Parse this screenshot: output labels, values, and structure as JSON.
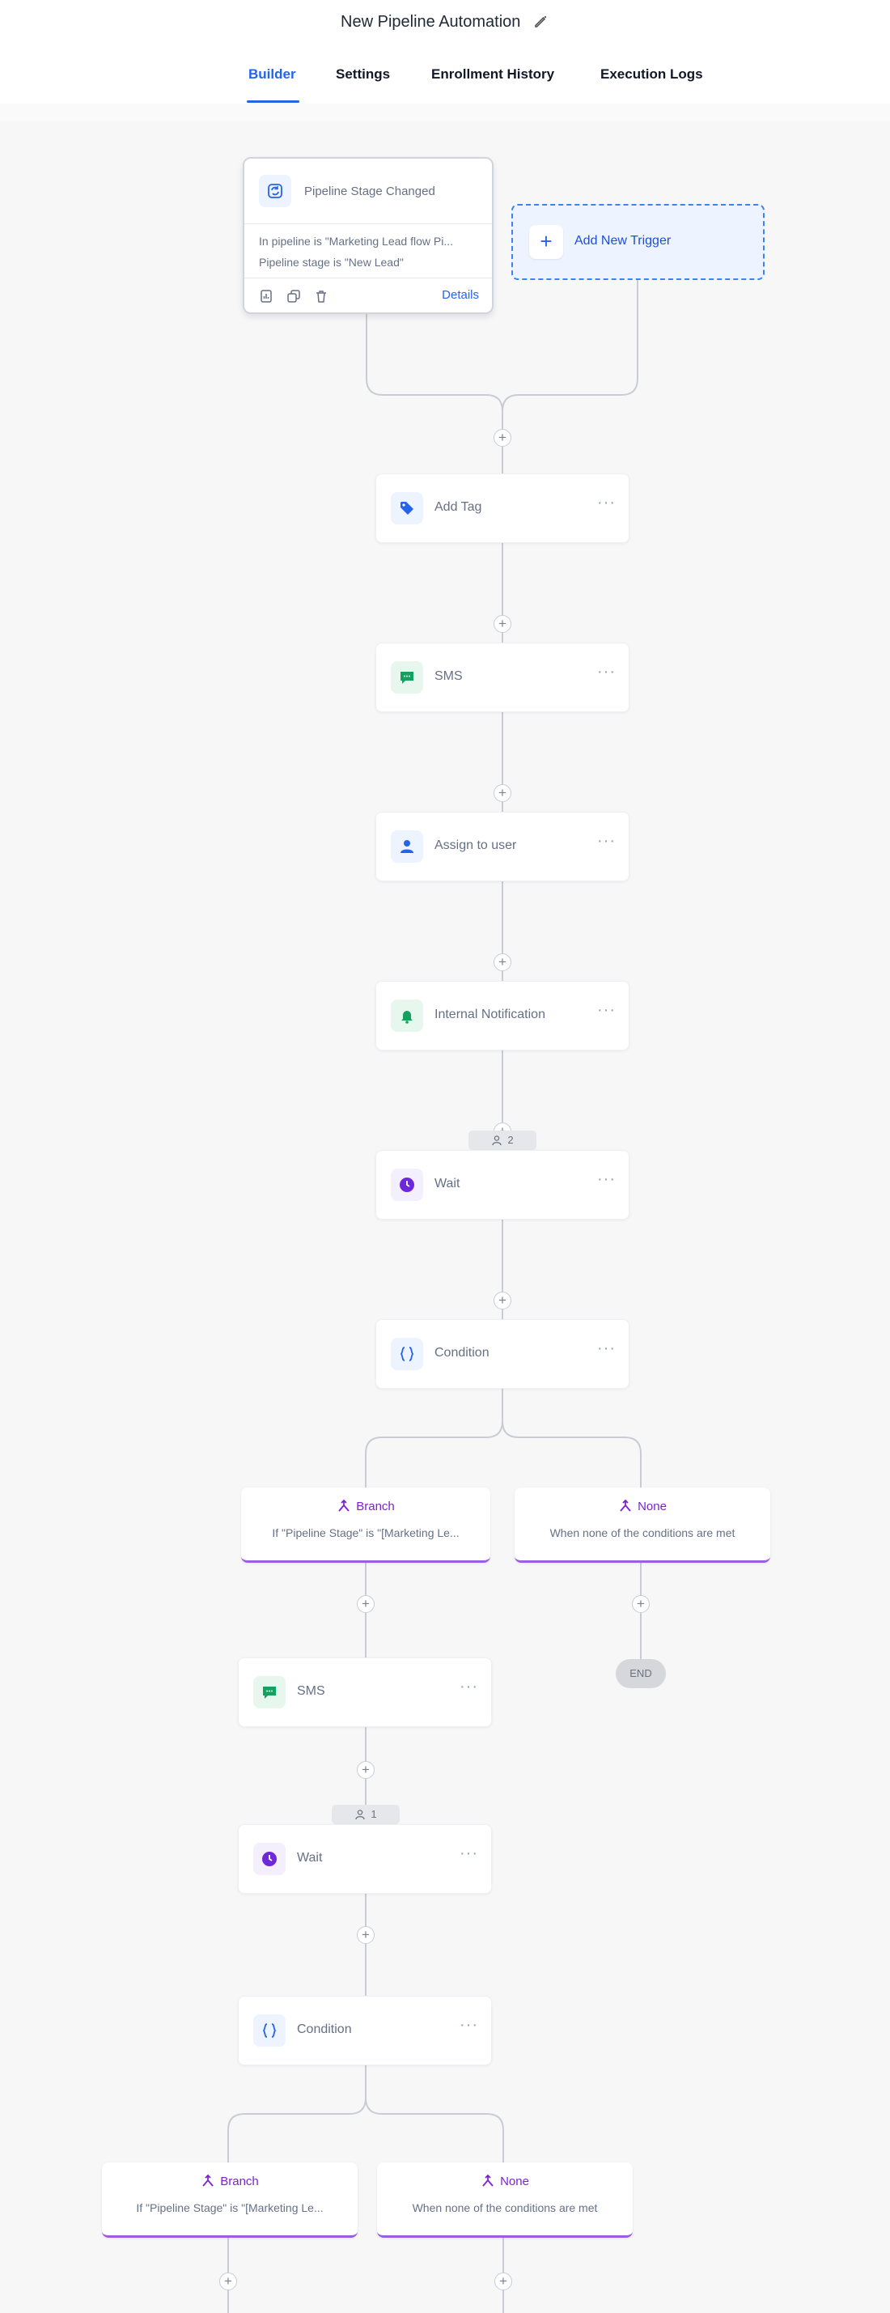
{
  "header": {
    "title": "New Pipeline Automation",
    "edit_icon": "pencil-icon"
  },
  "tabs": [
    {
      "label": "Builder",
      "active": true
    },
    {
      "label": "Settings",
      "active": false
    },
    {
      "label": "Enrollment History",
      "active": false
    },
    {
      "label": "Execution Logs",
      "active": false
    }
  ],
  "trigger": {
    "title": "Pipeline Stage Changed",
    "icon": "refresh-icon",
    "conditions": [
      "In pipeline is \"Marketing Lead flow Pi...",
      "Pipeline stage is \"New Lead\""
    ],
    "details_label": "Details",
    "footer_icons": [
      "stats-icon",
      "copy-icon",
      "trash-icon"
    ]
  },
  "add_trigger": {
    "label": "Add New Trigger",
    "icon": "plus-icon"
  },
  "actions": [
    {
      "label": "Add Tag",
      "icon": "tag-icon"
    },
    {
      "label": "SMS",
      "icon": "sms-icon"
    },
    {
      "label": "Assign to user",
      "icon": "user-icon"
    },
    {
      "label": "Internal Notification",
      "icon": "bell-icon"
    },
    {
      "label": "Wait",
      "icon": "clock-icon"
    },
    {
      "label": "Condition",
      "icon": "braces-icon"
    },
    {
      "label": "SMS",
      "icon": "sms-icon"
    },
    {
      "label": "Wait",
      "icon": "clock-icon"
    },
    {
      "label": "Condition",
      "icon": "braces-icon"
    }
  ],
  "wait_counts": [
    "2",
    "1"
  ],
  "branches": [
    {
      "title": "Branch",
      "subtitle": "If \"Pipeline Stage\" is \"[Marketing Le..."
    },
    {
      "title": "None",
      "subtitle": "When none of the conditions are met"
    },
    {
      "title": "Branch",
      "subtitle": "If \"Pipeline Stage\" is \"[Marketing Le..."
    },
    {
      "title": "None",
      "subtitle": "When none of the conditions are met"
    }
  ],
  "end_label": "END",
  "more_label": "···",
  "add_step_symbol": "+",
  "colors": {
    "accent": "#2563eb",
    "branch": "#9b5de5",
    "sms": "#12a15f",
    "wait": "#6d28d9"
  }
}
